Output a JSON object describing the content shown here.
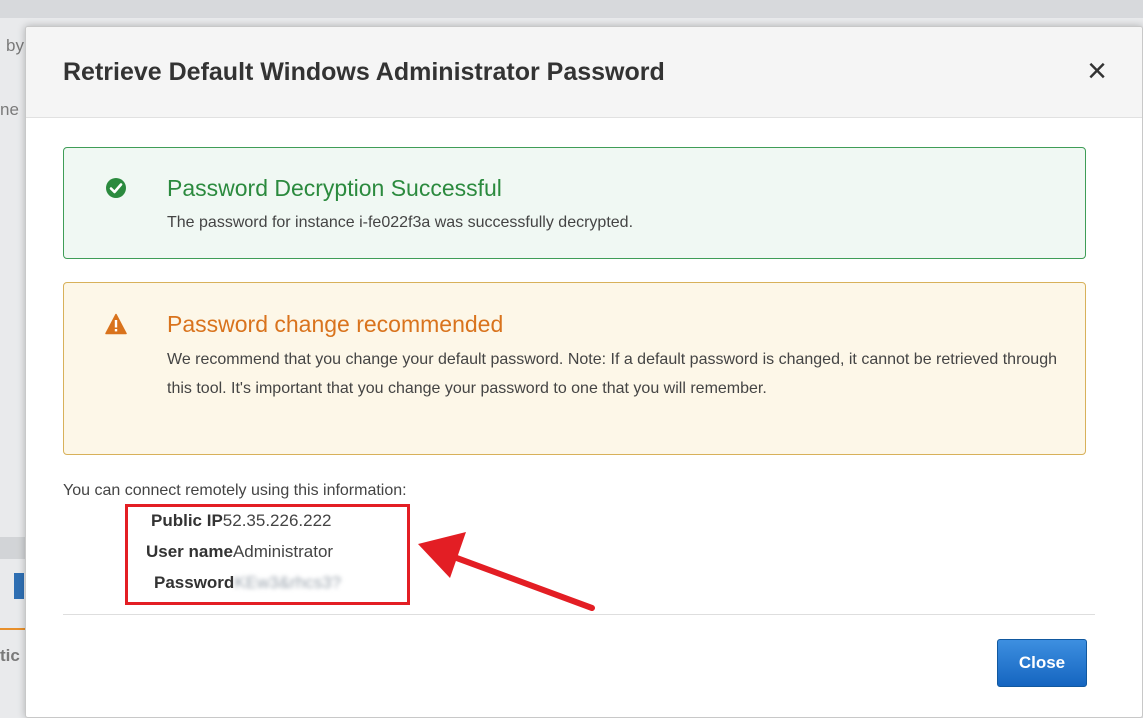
{
  "background": {
    "fragments": [
      "by",
      "ne",
      "tic"
    ]
  },
  "modal": {
    "title": "Retrieve Default Windows Administrator Password",
    "close_glyph": "×",
    "success_alert": {
      "icon": "check-circle-icon",
      "heading": "Password Decryption Successful",
      "body": "The password for instance i-fe022f3a was successfully decrypted."
    },
    "warning_alert": {
      "icon": "warning-triangle-icon",
      "heading": "Password change recommended",
      "body": "We recommend that you change your default password. Note: If a default password is changed, it cannot be retrieved through this tool. It's important that you change your password to one that you will remember."
    },
    "connect": {
      "intro": "You can connect remotely using this information:",
      "public_ip_label": "Public IP",
      "public_ip_value": "52.35.226.222",
      "user_name_label": "User name",
      "user_name_value": "Administrator",
      "password_label": "Password",
      "password_value": "KEw3&rhcs3?"
    },
    "close_button_label": "Close"
  },
  "colors": {
    "success": "#2b8a3e",
    "warning": "#d9731d",
    "primary_button": "#1f74d1",
    "annotation_red": "#e31e24"
  }
}
